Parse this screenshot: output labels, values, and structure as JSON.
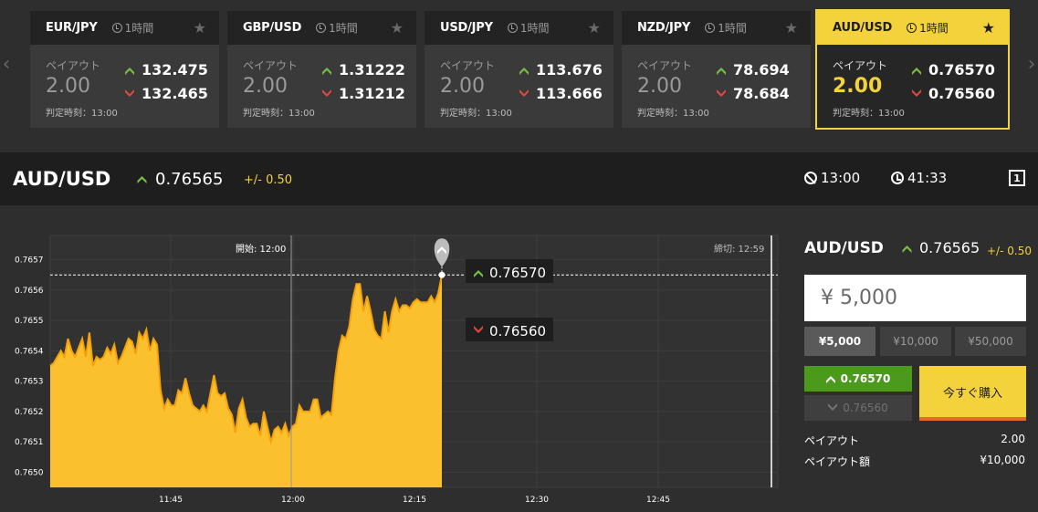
{
  "cards": [
    {
      "pair": "EUR/JPY",
      "period": "1時間",
      "payout_label": "ペイアウト",
      "payout": "2.00",
      "up": "132.475",
      "down": "132.465",
      "judge": "判定時刻：13:00",
      "active": false
    },
    {
      "pair": "GBP/USD",
      "period": "1時間",
      "payout_label": "ペイアウト",
      "payout": "2.00",
      "up": "1.31222",
      "down": "1.31212",
      "judge": "判定時刻：13:00",
      "active": false
    },
    {
      "pair": "USD/JPY",
      "period": "1時間",
      "payout_label": "ペイアウト",
      "payout": "2.00",
      "up": "113.676",
      "down": "113.666",
      "judge": "判定時刻：13:00",
      "active": false
    },
    {
      "pair": "NZD/JPY",
      "period": "1時間",
      "payout_label": "ペイアウト",
      "payout": "2.00",
      "up": "78.694",
      "down": "78.684",
      "judge": "判定時刻：13:00",
      "active": false
    },
    {
      "pair": "AUD/USD",
      "period": "1時間",
      "payout_label": "ペイアウト",
      "payout": "2.00",
      "up": "0.76570",
      "down": "0.76560",
      "judge": "判定時刻：13:00",
      "active": true
    }
  ],
  "header": {
    "pair": "AUD/USD",
    "rate": "0.76565",
    "change": "+/- 0.50",
    "judge_time": "13:00",
    "remaining": "41:33",
    "layout_icon_label": "1"
  },
  "chart": {
    "start_label": "開始: 12:00",
    "close_label": "締切: 12:59",
    "up_tag": "0.76570",
    "down_tag": "0.76560"
  },
  "chart_data": {
    "type": "area",
    "x_ticks": [
      "11:45",
      "12:00",
      "12:15",
      "12:30",
      "12:45"
    ],
    "y_ticks": [
      "0.7650",
      "0.7651",
      "0.7652",
      "0.7653",
      "0.7654",
      "0.7655",
      "0.7656",
      "0.7657"
    ],
    "ylim": [
      0.76495,
      0.76578
    ],
    "current": 0.76565,
    "colors": {
      "fill": "#fbc02d",
      "line": "#f5a20a"
    },
    "series": [
      {
        "values": [
          0.76535,
          0.76536,
          0.76538,
          0.7654,
          0.76538,
          0.76544,
          0.7654,
          0.76538,
          0.76541,
          0.76544,
          0.76538,
          0.76546,
          0.76535,
          0.76538,
          0.76537,
          0.76538,
          0.76541,
          0.76539,
          0.76542,
          0.76536,
          0.76538,
          0.76541,
          0.76544,
          0.76543,
          0.76539,
          0.76546,
          0.76544,
          0.76547,
          0.7654,
          0.76544,
          0.76542,
          0.76527,
          0.76521,
          0.76524,
          0.76522,
          0.76522,
          0.76527,
          0.76526,
          0.76531,
          0.76526,
          0.76522,
          0.76521,
          0.7652,
          0.76522,
          0.7652,
          0.76526,
          0.76532,
          0.76526,
          0.76525,
          0.76526,
          0.76521,
          0.76519,
          0.76513,
          0.76521,
          0.76524,
          0.76518,
          0.76515,
          0.76516,
          0.76516,
          0.76512,
          0.7652,
          0.76515,
          0.7651,
          0.76514,
          0.76515,
          0.76513,
          0.76516,
          0.76512,
          0.76515,
          0.76516,
          0.76522,
          0.7652,
          0.7652,
          0.7652,
          0.76524,
          0.76524,
          0.76518,
          0.76519,
          0.7652,
          0.76519,
          0.76531,
          0.7654,
          0.76545,
          0.76544,
          0.76548,
          0.76557,
          0.76562,
          0.76562,
          0.76553,
          0.76558,
          0.76553,
          0.76547,
          0.76545,
          0.76544,
          0.76553,
          0.76546,
          0.76553,
          0.76557,
          0.76553,
          0.76555,
          0.76555,
          0.76554,
          0.76556,
          0.76557,
          0.76556,
          0.76556,
          0.76556,
          0.76558,
          0.76556,
          0.76559,
          0.76565
        ]
      }
    ]
  },
  "side": {
    "pair": "AUD/USD",
    "rate": "0.76565",
    "change": "+/- 0.50",
    "amount": "¥ 5,000",
    "amount_buttons": [
      "¥5,000",
      "¥10,000",
      "¥50,000"
    ],
    "up_rate": "0.76570",
    "down_rate": "0.76560",
    "buy_now": "今すぐ購入",
    "payout_label": "ペイアウト",
    "payout_value": "2.00",
    "payout_amount_label": "ペイアウト額",
    "payout_amount_value": "¥10,000"
  }
}
